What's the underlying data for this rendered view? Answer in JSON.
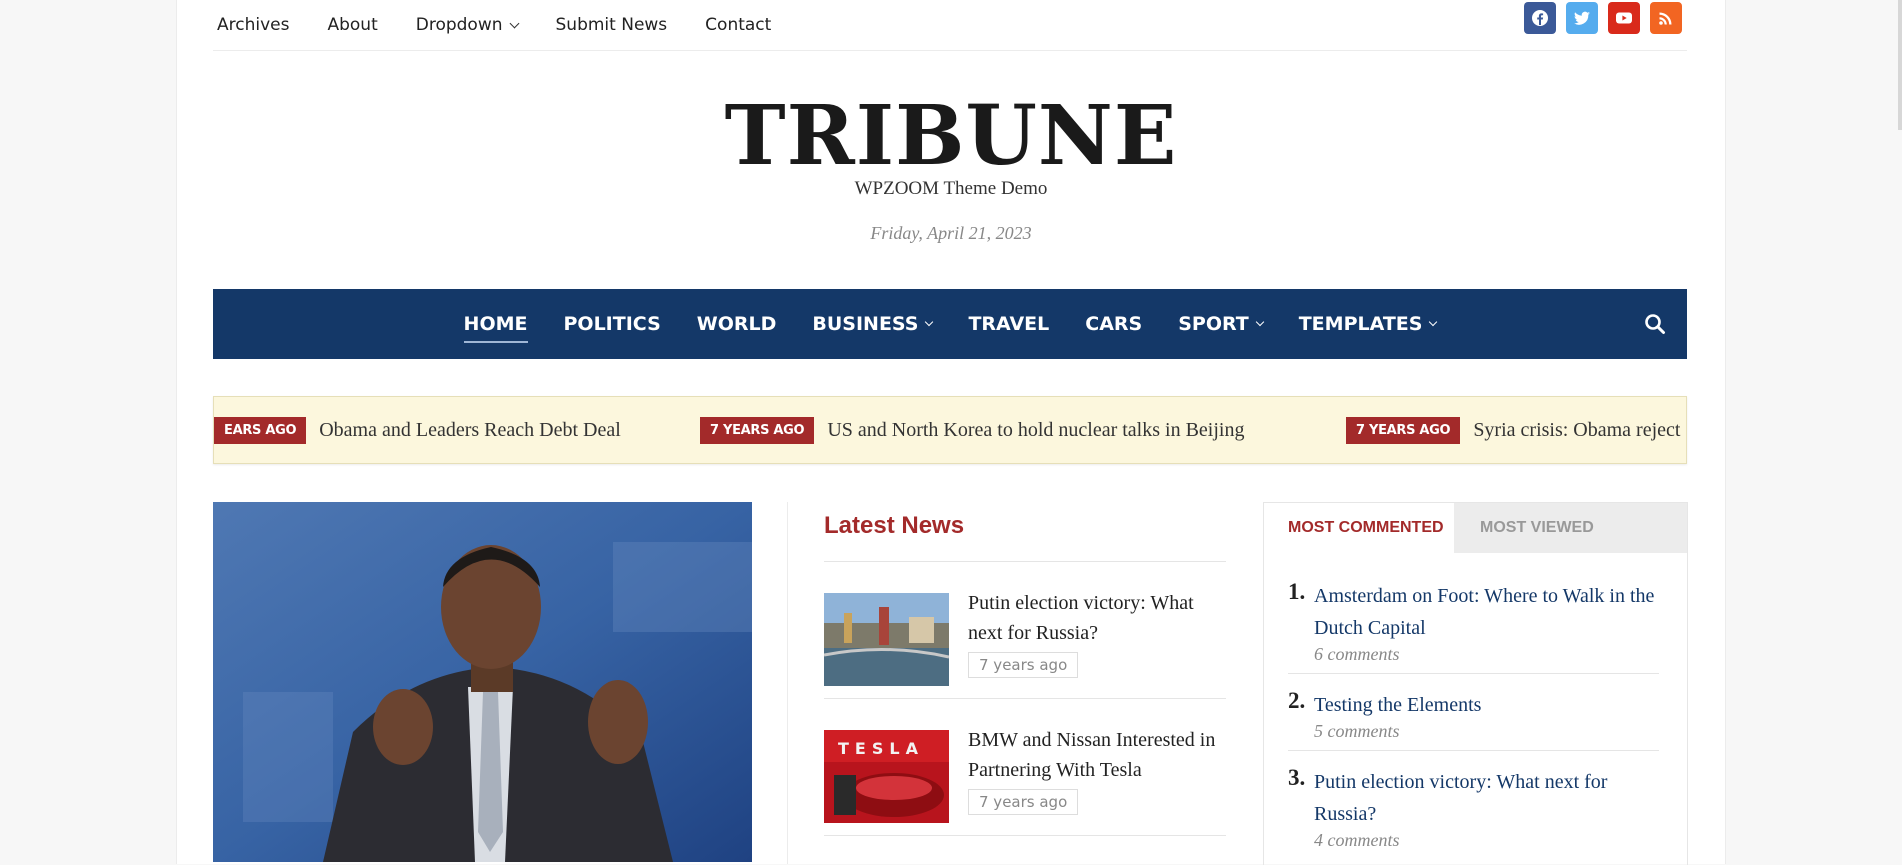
{
  "topnav": {
    "items": [
      "Archives",
      "About",
      "Dropdown",
      "Submit News",
      "Contact"
    ]
  },
  "social": {
    "icons": [
      "facebook-icon",
      "twitter-icon",
      "youtube-icon",
      "rss-icon"
    ]
  },
  "masthead": {
    "logo": "TRIBUNE",
    "tagline": "WPZOOM Theme Demo",
    "date": "Friday, April 21, 2023"
  },
  "mainnav": {
    "items": [
      "HOME",
      "POLITICS",
      "WORLD",
      "BUSINESS",
      "TRAVEL",
      "CARS",
      "SPORT",
      "TEMPLATES"
    ],
    "active": "HOME"
  },
  "ticker": {
    "items": [
      {
        "badge": "EARS AGO",
        "title": "Obama and Leaders Reach Debt Deal"
      },
      {
        "badge": "7 YEARS AGO",
        "title": "US and North Korea to hold nuclear talks in Beijing"
      },
      {
        "badge": "7 YEARS AGO",
        "title": "Syria crisis: Obama reject"
      }
    ]
  },
  "latest": {
    "heading": "Latest News",
    "items": [
      {
        "title": "Putin election victory: What next for Russia?",
        "time": "7 years ago"
      },
      {
        "title": "BMW and Nissan Interested in Partnering With Tesla",
        "time": "7 years ago"
      }
    ]
  },
  "popular": {
    "tabs": [
      "MOST COMMENTED",
      "MOST VIEWED"
    ],
    "items": [
      {
        "num": "1.",
        "title": "Amsterdam on Foot: Where to Walk in the Dutch Capital",
        "comments": "6 comments"
      },
      {
        "num": "2.",
        "title": "Testing the Elements",
        "comments": "5 comments"
      },
      {
        "num": "3.",
        "title": "Putin election victory: What next for Russia?",
        "comments": "4 comments"
      }
    ]
  },
  "colors": {
    "nav_bg": "#143868",
    "accent_red": "#a32a2a",
    "ticker_bg": "#fcf7dd"
  }
}
